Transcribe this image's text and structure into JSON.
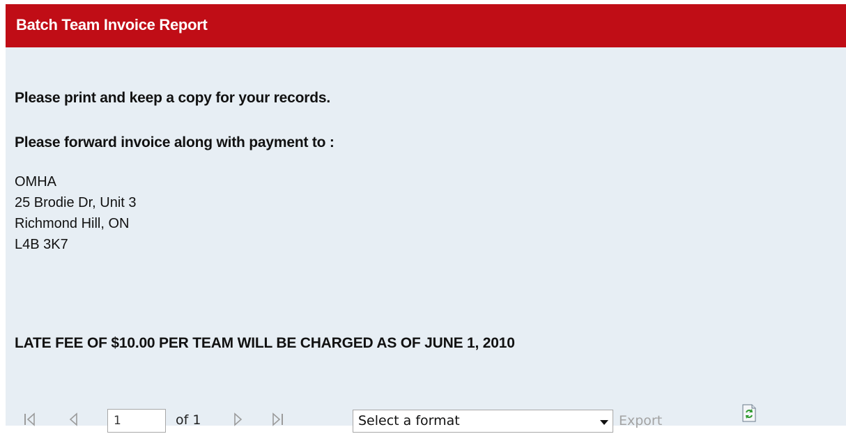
{
  "header": {
    "title": "Batch Team Invoice Report"
  },
  "report": {
    "line1": "Please print and keep a copy for your records.",
    "line2": "Please forward invoice along with payment to :",
    "address": [
      "OMHA",
      "25 Brodie Dr, Unit 3",
      "Richmond Hill, ON",
      "L4B 3K7"
    ],
    "notice": "LATE FEE OF $10.00 PER TEAM WILL BE CHARGED AS OF JUNE 1, 2010"
  },
  "toolbar": {
    "icons": {
      "first": "first-page-icon",
      "prev": "previous-page-icon",
      "next": "next-page-icon",
      "last": "last-page-icon",
      "dropdown": "chevron-down-icon",
      "refresh": "refresh-icon"
    },
    "page_value": "1",
    "of_label": "of 1",
    "format_selected": "Select a format",
    "export_label": "Export"
  },
  "colors": {
    "header_bg": "#c00d16",
    "panel_bg": "#e7eef4",
    "disabled": "#9b9b9b"
  }
}
